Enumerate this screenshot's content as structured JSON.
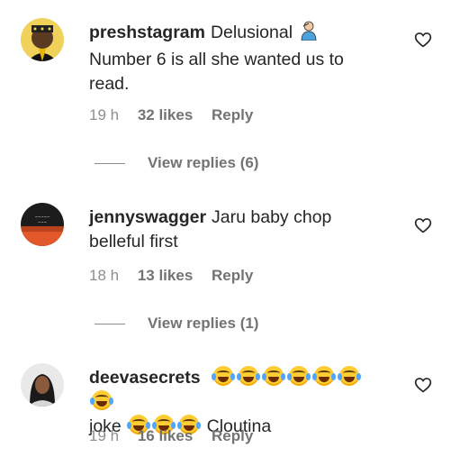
{
  "comments": [
    {
      "username": "preshstagram",
      "text": "Delusional",
      "text_cont": "Number 6 is all she wanted us to read.",
      "emoji": "person-facepalm-emoji",
      "time": "19 h",
      "likes": "32 likes",
      "reply": "Reply",
      "view_replies": "View replies (6)"
    },
    {
      "username": "jennyswagger",
      "text": "Jaru baby chop belleful first",
      "time": "18 h",
      "likes": "13 likes",
      "reply": "Reply",
      "view_replies": "View replies (1)"
    },
    {
      "username": "deevasecrets",
      "text_before": "joke",
      "text_after": "Cloutina",
      "emoji": "face-with-tears-of-joy-emoji",
      "time": "19 h",
      "likes": "16 likes",
      "reply": "Reply"
    }
  ],
  "icons": {
    "like": "heart-outline-icon"
  },
  "colors": {
    "text": "#262626",
    "secondary": "#8e8e8e",
    "background": "#ffffff"
  }
}
